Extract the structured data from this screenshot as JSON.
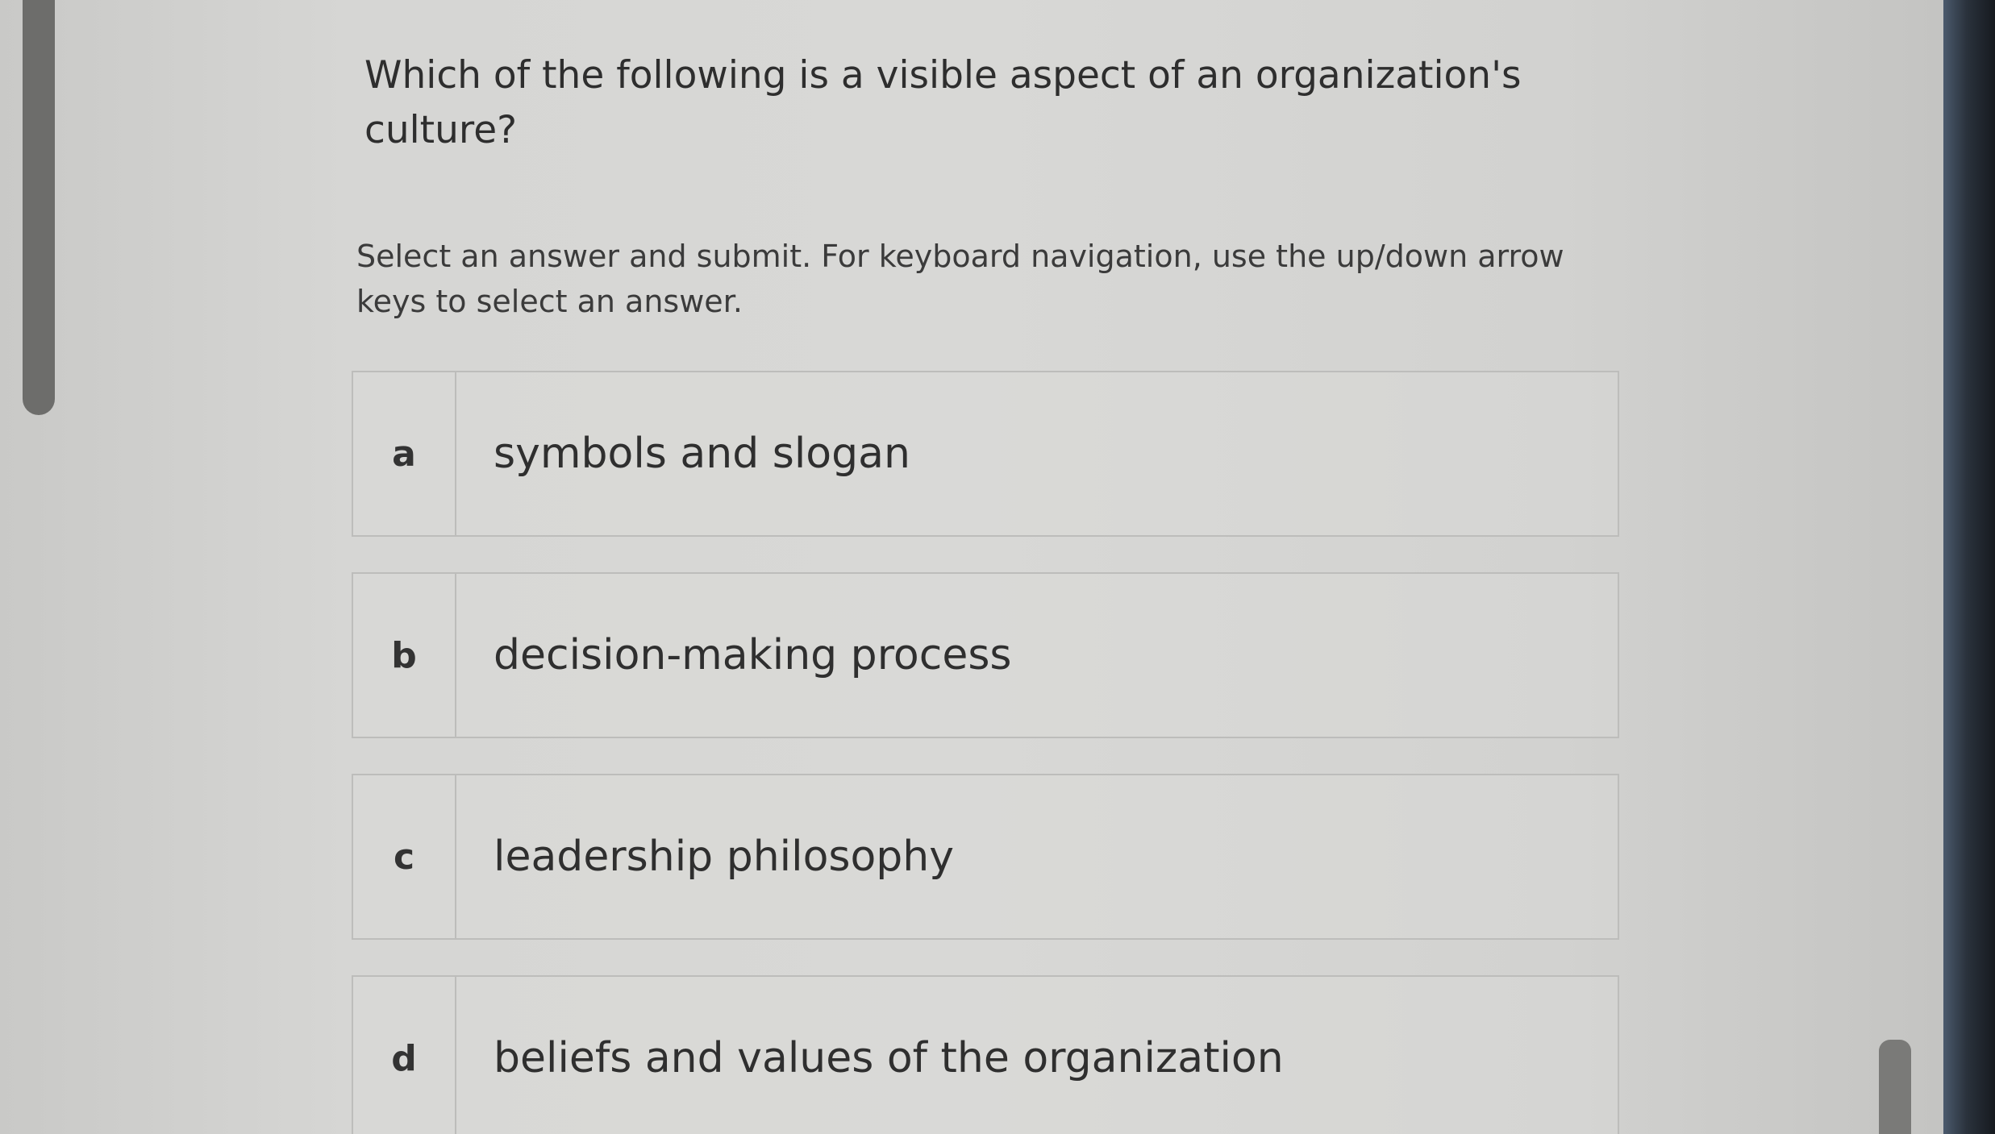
{
  "question": {
    "text": "Which of the following is a visible aspect of an organization's culture?"
  },
  "instructions": {
    "text": "Select an answer and submit. For keyboard navigation, use the up/down arrow keys to select an answer."
  },
  "options": [
    {
      "letter": "a",
      "text": "symbols and slogan"
    },
    {
      "letter": "b",
      "text": "decision-making process"
    },
    {
      "letter": "c",
      "text": "leadership philosophy"
    },
    {
      "letter": "d",
      "text": "beliefs and values of the organization"
    }
  ],
  "colors": {
    "background": "#d6d6d4",
    "text": "#2e2e2e",
    "border": "#bdbdbb",
    "scrollbar": "#6d6d6b"
  }
}
